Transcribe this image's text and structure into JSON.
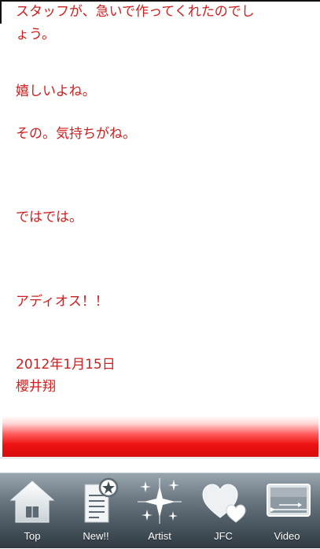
{
  "content": {
    "lines": [
      "スタッフが、急いで作ってくれたのでし",
      "ょう。",
      "嬉しいよね。",
      "その。気持ちがね。",
      "ではでは。",
      "アディオス！！",
      "2012年1月15日",
      "櫻井翔"
    ],
    "text_color": "#cc1f1f"
  },
  "tabbar": {
    "tabs": [
      {
        "label": "Top",
        "icon": "home-icon"
      },
      {
        "label": "New!!",
        "icon": "new-document-icon"
      },
      {
        "label": "Artist",
        "icon": "sparkle-icon"
      },
      {
        "label": "JFC",
        "icon": "hearts-icon"
      },
      {
        "label": "Video",
        "icon": "video-icon"
      }
    ]
  },
  "colors": {
    "red_bar": "#e01010",
    "tabbar_top": "#9aa6ae",
    "tabbar_bottom": "#2f3a41"
  }
}
